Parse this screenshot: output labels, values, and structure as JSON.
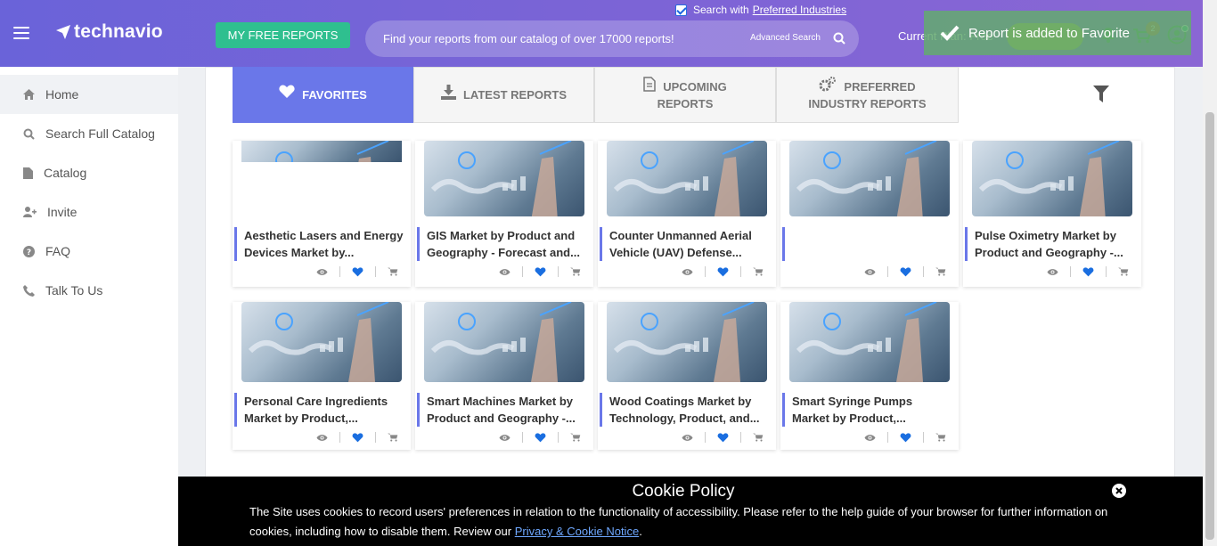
{
  "header": {
    "logo_text": "technavio",
    "free_reports_label": "MY FREE REPORTS",
    "preferred_prefix": "Search with",
    "preferred_link": "Preferred Industries",
    "search_placeholder": "Find your reports from our catalog of over 17000 reports!",
    "advanced_search_label": "Advanced Search",
    "current_plan_label": "Current Plan: Free",
    "toast_message": "Report is added to Favorite",
    "cart_count": "2"
  },
  "sidebar": {
    "items": [
      {
        "label": "Home",
        "icon": "home-icon"
      },
      {
        "label": "Search Full Catalog",
        "icon": "search-icon"
      },
      {
        "label": "Catalog",
        "icon": "document-icon"
      },
      {
        "label": "Invite",
        "icon": "user-plus-icon"
      },
      {
        "label": "FAQ",
        "icon": "question-icon"
      },
      {
        "label": "Talk To Us",
        "icon": "phone-icon"
      }
    ]
  },
  "tabs": [
    {
      "label": "FAVORITES",
      "icon": "heart-icon"
    },
    {
      "label": "LATEST REPORTS",
      "icon": "download-icon"
    },
    {
      "label_line1": "UPCOMING",
      "label_line2": "REPORTS",
      "icon": "file-icon"
    },
    {
      "label_line1": "PREFERRED",
      "label_line2": "INDUSTRY REPORTS",
      "icon": "gears-icon"
    }
  ],
  "reports": [
    {
      "title": "Aesthetic Lasers and Energy Devices Market by..."
    },
    {
      "title": "GIS Market by Product and Geography - Forecast and..."
    },
    {
      "title": "Counter Unmanned Aerial Vehicle (UAV) Defense..."
    },
    {
      "title": ""
    },
    {
      "title": "Pulse Oximetry Market by Product and Geography -..."
    },
    {
      "title": "Personal Care Ingredients Market by Product,..."
    },
    {
      "title": "Smart Machines Market by Product and Geography -..."
    },
    {
      "title": "Wood Coatings Market by Technology, Product, and..."
    },
    {
      "title": "Smart Syringe Pumps Market by Product,..."
    }
  ],
  "cookie": {
    "title": "Cookie Policy",
    "text": "The Site uses cookies to record users' preferences in relation to the functionality of accessibility. Please refer to the help guide of your browser for further information on cookies, including how to disable them. Review our",
    "link": "Privacy & Cookie Notice",
    "end": "."
  },
  "colors": {
    "header_gradient_start": "#6a63d9",
    "header_gradient_end": "#8a66d4",
    "accent": "#6a77e9",
    "free_button": "#2fbf8f",
    "heart": "#1a6ee0"
  }
}
